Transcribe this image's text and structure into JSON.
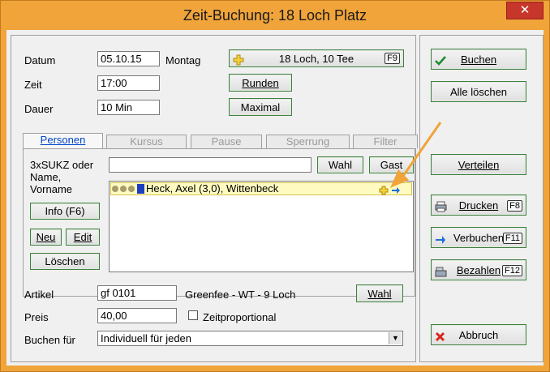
{
  "window": {
    "title": "Zeit-Buchung: 18 Loch Platz",
    "close_label": "✕"
  },
  "form": {
    "datum_label": "Datum",
    "datum_value": "05.10.15",
    "weekday": "Montag",
    "zeit_label": "Zeit",
    "zeit_value": "17:00",
    "dauer_label": "Dauer",
    "dauer_value": "10 Min",
    "course_button": "18 Loch, 10 Tee",
    "course_key": "F9",
    "runden_button": "Runden",
    "maximal_button": "Maximal"
  },
  "tabs": [
    {
      "label": "Personen",
      "active": true
    },
    {
      "label": "Kursus",
      "active": false
    },
    {
      "label": "Pause",
      "active": false
    },
    {
      "label": "Sperrung",
      "active": false
    },
    {
      "label": "Filter",
      "active": false
    }
  ],
  "personen": {
    "search_label_1": "3xSUKZ oder",
    "search_label_2": "Name,",
    "search_label_3": "Vorname",
    "search_value": "",
    "wahl_button": "Wahl",
    "gast_button": "Gast",
    "info_button": "Info (F6)",
    "neu_button": "Neu",
    "edit_button": "Edit",
    "loeschen_button": "Löschen",
    "players": [
      {
        "name": "Heck, Axel (3,0), Wittenbeck"
      }
    ]
  },
  "artikel": {
    "artikel_label": "Artikel",
    "artikel_value": "gf     0101",
    "artikel_desc": "Greenfee - WT - 9 Loch",
    "wahl_button": "Wahl",
    "preis_label": "Preis",
    "preis_value": "40,00",
    "zeitproportional_label": "Zeitproportional",
    "zeitproportional_checked": false,
    "buchen_fuer_label": "Buchen für",
    "buchen_fuer_value": "Individuell für jeden"
  },
  "actions": {
    "buchen": "Buchen",
    "alle_loeschen": "Alle löschen",
    "verteilen": "Verteilen",
    "drucken": "Drucken",
    "drucken_key": "F8",
    "verbuchen": "Verbuchen",
    "verbuchen_key": "F11",
    "bezahlen": "Bezahlen",
    "bezahlen_key": "F12",
    "abbruch": "Abbruch"
  },
  "colors": {
    "frame": "#f0a43a",
    "accent_blue": "#0046c8",
    "row_highlight": "#fffbc0",
    "annotation_arrow": "#f0a43a"
  }
}
